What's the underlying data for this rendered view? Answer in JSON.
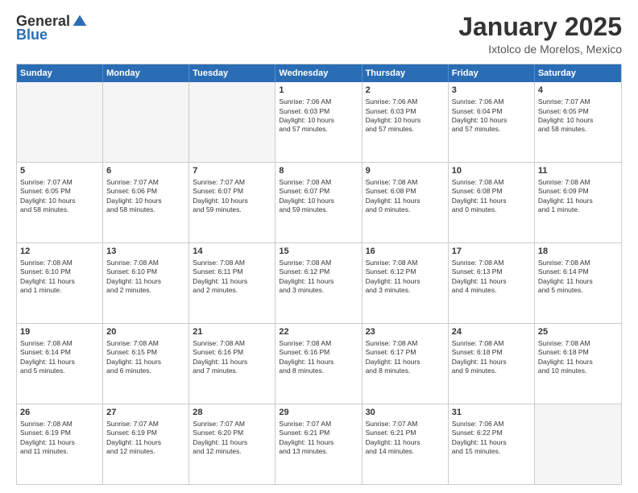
{
  "logo": {
    "general": "General",
    "blue": "Blue"
  },
  "title": "January 2025",
  "location": "Ixtolco de Morelos, Mexico",
  "header_days": [
    "Sunday",
    "Monday",
    "Tuesday",
    "Wednesday",
    "Thursday",
    "Friday",
    "Saturday"
  ],
  "weeks": [
    [
      {
        "day": "",
        "sunrise": "",
        "sunset": "",
        "daylight": "",
        "empty": true
      },
      {
        "day": "",
        "sunrise": "",
        "sunset": "",
        "daylight": "",
        "empty": true
      },
      {
        "day": "",
        "sunrise": "",
        "sunset": "",
        "daylight": "",
        "empty": true
      },
      {
        "day": "1",
        "sunrise": "Sunrise: 7:06 AM",
        "sunset": "Sunset: 6:03 PM",
        "daylight": "Daylight: 10 hours and 57 minutes."
      },
      {
        "day": "2",
        "sunrise": "Sunrise: 7:06 AM",
        "sunset": "Sunset: 6:03 PM",
        "daylight": "Daylight: 10 hours and 57 minutes."
      },
      {
        "day": "3",
        "sunrise": "Sunrise: 7:06 AM",
        "sunset": "Sunset: 6:04 PM",
        "daylight": "Daylight: 10 hours and 57 minutes."
      },
      {
        "day": "4",
        "sunrise": "Sunrise: 7:07 AM",
        "sunset": "Sunset: 6:05 PM",
        "daylight": "Daylight: 10 hours and 58 minutes."
      }
    ],
    [
      {
        "day": "5",
        "sunrise": "Sunrise: 7:07 AM",
        "sunset": "Sunset: 6:05 PM",
        "daylight": "Daylight: 10 hours and 58 minutes."
      },
      {
        "day": "6",
        "sunrise": "Sunrise: 7:07 AM",
        "sunset": "Sunset: 6:06 PM",
        "daylight": "Daylight: 10 hours and 58 minutes."
      },
      {
        "day": "7",
        "sunrise": "Sunrise: 7:07 AM",
        "sunset": "Sunset: 6:07 PM",
        "daylight": "Daylight: 10 hours and 59 minutes."
      },
      {
        "day": "8",
        "sunrise": "Sunrise: 7:08 AM",
        "sunset": "Sunset: 6:07 PM",
        "daylight": "Daylight: 10 hours and 59 minutes."
      },
      {
        "day": "9",
        "sunrise": "Sunrise: 7:08 AM",
        "sunset": "Sunset: 6:08 PM",
        "daylight": "Daylight: 11 hours and 0 minutes."
      },
      {
        "day": "10",
        "sunrise": "Sunrise: 7:08 AM",
        "sunset": "Sunset: 6:08 PM",
        "daylight": "Daylight: 11 hours and 0 minutes."
      },
      {
        "day": "11",
        "sunrise": "Sunrise: 7:08 AM",
        "sunset": "Sunset: 6:09 PM",
        "daylight": "Daylight: 11 hours and 1 minute."
      }
    ],
    [
      {
        "day": "12",
        "sunrise": "Sunrise: 7:08 AM",
        "sunset": "Sunset: 6:10 PM",
        "daylight": "Daylight: 11 hours and 1 minute."
      },
      {
        "day": "13",
        "sunrise": "Sunrise: 7:08 AM",
        "sunset": "Sunset: 6:10 PM",
        "daylight": "Daylight: 11 hours and 2 minutes."
      },
      {
        "day": "14",
        "sunrise": "Sunrise: 7:08 AM",
        "sunset": "Sunset: 6:11 PM",
        "daylight": "Daylight: 11 hours and 2 minutes."
      },
      {
        "day": "15",
        "sunrise": "Sunrise: 7:08 AM",
        "sunset": "Sunset: 6:12 PM",
        "daylight": "Daylight: 11 hours and 3 minutes."
      },
      {
        "day": "16",
        "sunrise": "Sunrise: 7:08 AM",
        "sunset": "Sunset: 6:12 PM",
        "daylight": "Daylight: 11 hours and 3 minutes."
      },
      {
        "day": "17",
        "sunrise": "Sunrise: 7:08 AM",
        "sunset": "Sunset: 6:13 PM",
        "daylight": "Daylight: 11 hours and 4 minutes."
      },
      {
        "day": "18",
        "sunrise": "Sunrise: 7:08 AM",
        "sunset": "Sunset: 6:14 PM",
        "daylight": "Daylight: 11 hours and 5 minutes."
      }
    ],
    [
      {
        "day": "19",
        "sunrise": "Sunrise: 7:08 AM",
        "sunset": "Sunset: 6:14 PM",
        "daylight": "Daylight: 11 hours and 5 minutes."
      },
      {
        "day": "20",
        "sunrise": "Sunrise: 7:08 AM",
        "sunset": "Sunset: 6:15 PM",
        "daylight": "Daylight: 11 hours and 6 minutes."
      },
      {
        "day": "21",
        "sunrise": "Sunrise: 7:08 AM",
        "sunset": "Sunset: 6:16 PM",
        "daylight": "Daylight: 11 hours and 7 minutes."
      },
      {
        "day": "22",
        "sunrise": "Sunrise: 7:08 AM",
        "sunset": "Sunset: 6:16 PM",
        "daylight": "Daylight: 11 hours and 8 minutes."
      },
      {
        "day": "23",
        "sunrise": "Sunrise: 7:08 AM",
        "sunset": "Sunset: 6:17 PM",
        "daylight": "Daylight: 11 hours and 8 minutes."
      },
      {
        "day": "24",
        "sunrise": "Sunrise: 7:08 AM",
        "sunset": "Sunset: 6:18 PM",
        "daylight": "Daylight: 11 hours and 9 minutes."
      },
      {
        "day": "25",
        "sunrise": "Sunrise: 7:08 AM",
        "sunset": "Sunset: 6:18 PM",
        "daylight": "Daylight: 11 hours and 10 minutes."
      }
    ],
    [
      {
        "day": "26",
        "sunrise": "Sunrise: 7:08 AM",
        "sunset": "Sunset: 6:19 PM",
        "daylight": "Daylight: 11 hours and 11 minutes."
      },
      {
        "day": "27",
        "sunrise": "Sunrise: 7:07 AM",
        "sunset": "Sunset: 6:19 PM",
        "daylight": "Daylight: 11 hours and 12 minutes."
      },
      {
        "day": "28",
        "sunrise": "Sunrise: 7:07 AM",
        "sunset": "Sunset: 6:20 PM",
        "daylight": "Daylight: 11 hours and 12 minutes."
      },
      {
        "day": "29",
        "sunrise": "Sunrise: 7:07 AM",
        "sunset": "Sunset: 6:21 PM",
        "daylight": "Daylight: 11 hours and 13 minutes."
      },
      {
        "day": "30",
        "sunrise": "Sunrise: 7:07 AM",
        "sunset": "Sunset: 6:21 PM",
        "daylight": "Daylight: 11 hours and 14 minutes."
      },
      {
        "day": "31",
        "sunrise": "Sunrise: 7:06 AM",
        "sunset": "Sunset: 6:22 PM",
        "daylight": "Daylight: 11 hours and 15 minutes."
      },
      {
        "day": "",
        "sunrise": "",
        "sunset": "",
        "daylight": "",
        "empty": true
      }
    ]
  ]
}
